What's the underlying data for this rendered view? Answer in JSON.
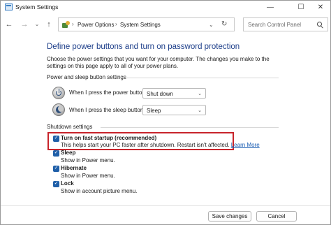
{
  "window": {
    "title": "System Settings",
    "controls": {
      "minimize": "—",
      "maximize": "☐",
      "close": "✕"
    }
  },
  "nav": {
    "back": "←",
    "forward": "→",
    "recent": "⌄",
    "up": "↑"
  },
  "address": {
    "separator": "›",
    "crumbs": [
      "Power Options",
      "System Settings"
    ],
    "dropdown": "⌄",
    "refresh": "↻"
  },
  "search": {
    "placeholder": "Search Control Panel"
  },
  "page": {
    "heading": "Define power buttons and turn on password protection",
    "intro": "Choose the power settings that you want for your computer. The changes you make to the settings on this page apply to all of your power plans."
  },
  "power_group": {
    "label": "Power and sleep button settings",
    "rows": [
      {
        "label": "When I press the power button:",
        "value": "Shut down"
      },
      {
        "label": "When I press the sleep button:",
        "value": "Sleep"
      }
    ]
  },
  "shutdown_group": {
    "label": "Shutdown settings",
    "options": [
      {
        "label": "Turn on fast startup (recommended)",
        "desc": "This helps start your PC faster after shutdown. Restart isn't affected.",
        "link": "Learn More",
        "checked": true
      },
      {
        "label": "Sleep",
        "desc": "Show in Power menu.",
        "checked": true
      },
      {
        "label": "Hibernate",
        "desc": "Show in Power menu.",
        "checked": true
      },
      {
        "label": "Lock",
        "desc": "Show in account picture menu.",
        "checked": true
      }
    ]
  },
  "buttons": {
    "save": "Save changes",
    "cancel": "Cancel"
  },
  "colors": {
    "heading": "#1e3f8a",
    "highlight_border": "#c8242b",
    "checkbox": "#1f5fa8",
    "link": "#1a5db3"
  },
  "icons": {
    "power": "power-button-icon",
    "sleep": "sleep-moon-icon",
    "checkmark": "✓"
  }
}
